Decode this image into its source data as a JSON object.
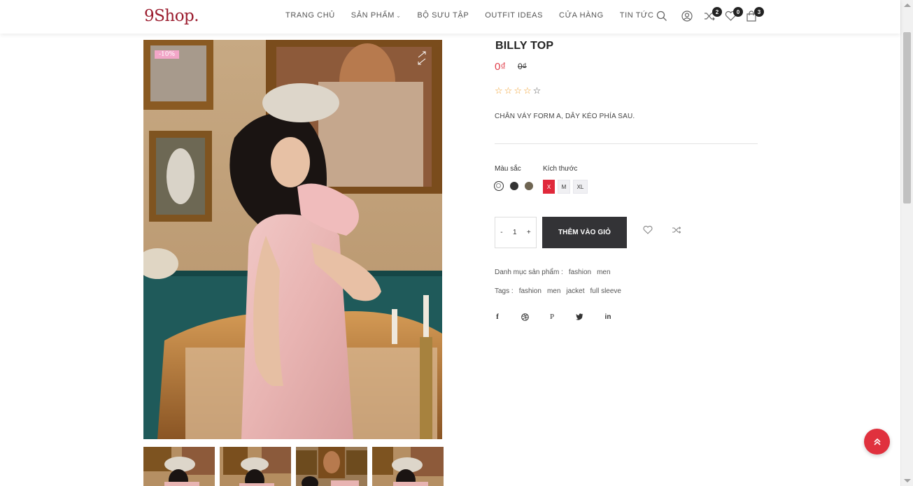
{
  "header": {
    "logo": "9Shop.",
    "nav": [
      {
        "label": "TRANG CHỦ",
        "dropdown": false
      },
      {
        "label": "SẢN PHẨM",
        "dropdown": true
      },
      {
        "label": "BỘ SƯU TẬP",
        "dropdown": false
      },
      {
        "label": "OUTFIT IDEAS",
        "dropdown": false
      },
      {
        "label": "CỬA HÀNG",
        "dropdown": false
      },
      {
        "label": "TIN TỨC",
        "dropdown": false
      }
    ],
    "icons": {
      "search": "search-icon",
      "account": "user-icon",
      "compare": "shuffle-icon",
      "wishlist": "heart-icon",
      "cart": "bag-icon"
    },
    "compare_count": "2",
    "wishlist_count": "0",
    "cart_count": "3"
  },
  "gallery": {
    "sale_badge": "-10%",
    "thumbnail_count": 4
  },
  "product": {
    "title": "BILLY TOP",
    "price": "0₫",
    "old_price": "0₫",
    "rating": 0,
    "rating_max": 5,
    "description": "CHÂN VÁY FORM A, DÂY KÉO PHÍA SAU.",
    "color_label": "Màu sắc",
    "size_label": "Kích thước",
    "colors": [
      "#ffffff",
      "#333333",
      "#6f6552"
    ],
    "selected_color": 0,
    "sizes": [
      "X",
      "M",
      "XL"
    ],
    "selected_size": "X",
    "quantity_minus": "-",
    "quantity": "1",
    "quantity_plus": "+",
    "add_to_cart": "THÊM VÀO GIỎ",
    "category_label": "Danh mục sản phẩm :",
    "categories": [
      "fashion",
      "men"
    ],
    "tags_label": "Tags :",
    "tags": [
      "fashion",
      "men",
      "jacket",
      "full sleeve"
    ],
    "social": [
      "facebook-icon",
      "dribbble-icon",
      "pinterest-icon",
      "twitter-icon",
      "linkedin-icon"
    ]
  },
  "colors": {
    "accent": "#e0283a",
    "logo": "#9b1c2e",
    "button_dark": "#333336",
    "sale_badge": "#f2a6c8",
    "star": "#f0a030"
  }
}
